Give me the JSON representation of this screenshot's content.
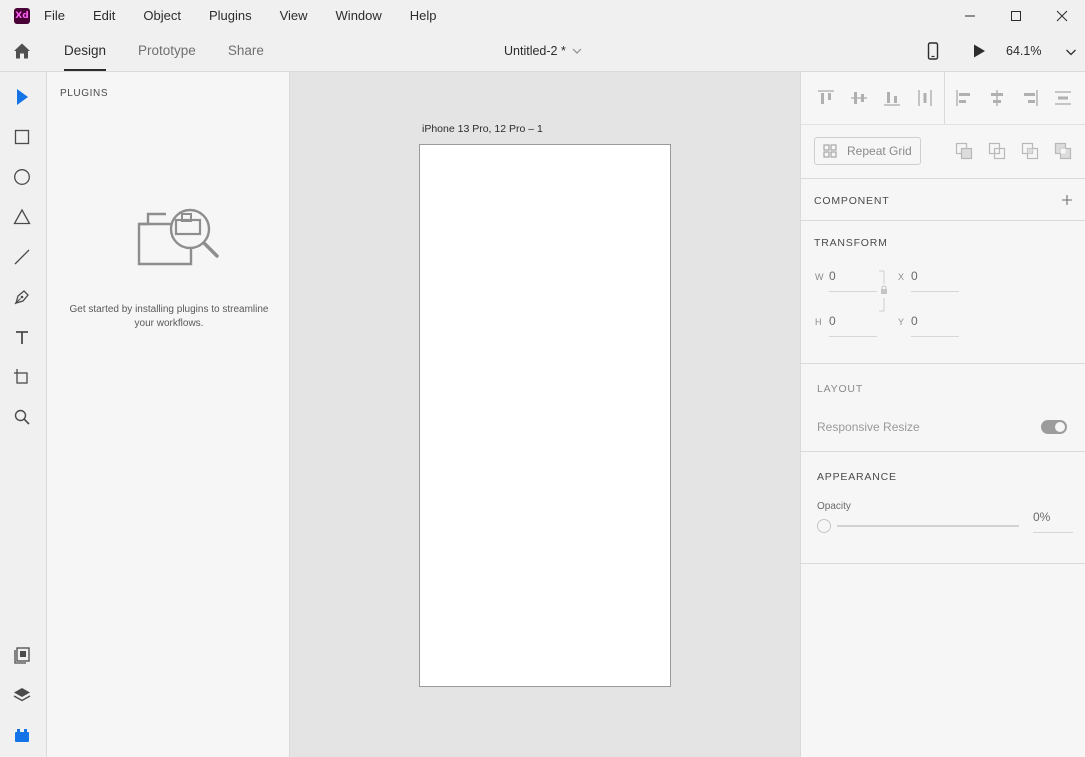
{
  "app": {
    "logo_text": "Xd"
  },
  "menu": [
    "File",
    "Edit",
    "Object",
    "Plugins",
    "View",
    "Window",
    "Help"
  ],
  "toolbar": {
    "tabs": [
      {
        "label": "Design",
        "active": true
      },
      {
        "label": "Prototype",
        "active": false
      },
      {
        "label": "Share",
        "active": false
      }
    ],
    "document_title": "Untitled-2 *",
    "zoom": "64.1%"
  },
  "plugins_panel": {
    "title": "PLUGINS",
    "message": "Get started by installing plugins to streamline your workflows."
  },
  "canvas": {
    "artboard_label": "iPhone 13 Pro, 12 Pro – 1"
  },
  "inspector": {
    "repeat_grid_label": "Repeat Grid",
    "component_title": "COMPONENT",
    "transform_title": "TRANSFORM",
    "transform": {
      "w_label": "W",
      "w_value": "0",
      "x_label": "X",
      "x_value": "0",
      "h_label": "H",
      "h_value": "0",
      "y_label": "Y",
      "y_value": "0"
    },
    "layout_title": "LAYOUT",
    "responsive_resize_label": "Responsive Resize",
    "responsive_resize_on": true,
    "appearance_title": "APPEARANCE",
    "opacity_label": "Opacity",
    "opacity_value": "0%"
  },
  "colors": {
    "accent": "#1473e6",
    "logo_bg": "#470137",
    "logo_fg": "#ff61f6"
  },
  "icons": {
    "tools": [
      "select-icon",
      "rectangle-icon",
      "ellipse-icon",
      "polygon-icon",
      "line-icon",
      "pen-icon",
      "text-icon",
      "artboard-icon",
      "zoom-icon"
    ],
    "bottom_tools": [
      "assets-icon",
      "layers-icon",
      "plugins-icon"
    ]
  }
}
